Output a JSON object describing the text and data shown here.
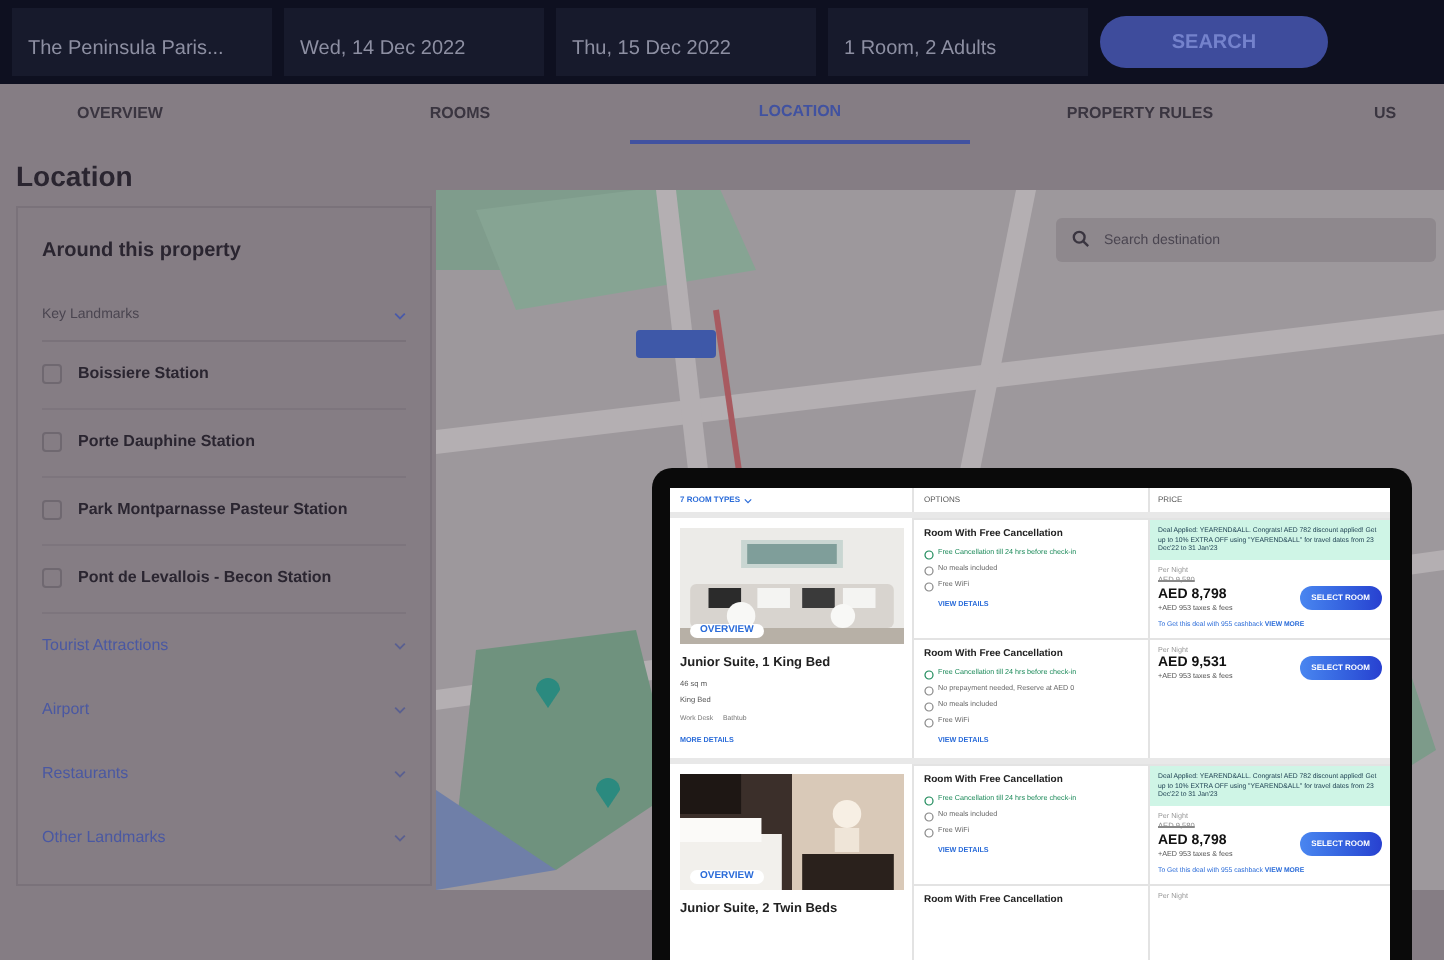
{
  "search_bar": {
    "fields": [
      {
        "value": "The Peninsula Paris..."
      },
      {
        "value": "Wed, 14 Dec 2022"
      },
      {
        "value": "Thu, 15 Dec 2022"
      },
      {
        "value": "1 Room, 2 Adults"
      }
    ],
    "button": "SEARCH"
  },
  "tabs": [
    {
      "label": "OVERVIEW",
      "selected": false
    },
    {
      "label": "ROOMS",
      "selected": false
    },
    {
      "label": "LOCATION",
      "selected": true
    },
    {
      "label": "PROPERTY RULES",
      "selected": false
    },
    {
      "label": "US",
      "selected": false
    }
  ],
  "location": {
    "title": "Location",
    "panel_title": "Around this property",
    "dropdown": "Key Landmarks",
    "landmarks": [
      {
        "name": "Boissiere Station",
        "checked": false
      },
      {
        "name": "Porte Dauphine Station",
        "checked": false
      },
      {
        "name": "Park Montparnasse Pasteur Station",
        "checked": false
      },
      {
        "name": "Pont de Levallois - Becon Station",
        "checked": false
      }
    ],
    "categories": [
      "Tourist Attractions",
      "Airport",
      "Restaurants",
      "Other Landmarks"
    ],
    "map": {
      "search_placeholder": "Search destination"
    }
  },
  "rooms_table": {
    "columns": [
      "7 ROOM TYPES",
      "OPTIONS",
      "PRICE"
    ],
    "rooms": [
      {
        "name": "Junior Suite, 1 King Bed",
        "badge": "OVERVIEW",
        "features": [
          "46 sq m",
          "King Bed"
        ],
        "amenities": [
          "Work Desk",
          "Bathtub"
        ],
        "more": "MORE DETAILS",
        "options": [
          {
            "title": "Room With Free Cancellation",
            "perks": [
              {
                "kind": "highlight",
                "text": "Free Cancellation till 24 hrs before check-in"
              },
              {
                "kind": "plain",
                "text": "No meals included"
              },
              {
                "kind": "plain",
                "text": "Free WiFi"
              }
            ],
            "link": "VIEW DETAILS",
            "price": {
              "deal": "Deal Applied: YEAREND&ALL. Congrats! AED 782 discount applied! Get up to 10% EXTRA OFF using \"YEAREND&ALL\" for travel dates from 23 Dec'22 to 31 Jan'23",
              "per_night": "Per Night",
              "original": "AED 9,580",
              "amount": "AED 8,798",
              "taxes": "+AED 953 taxes & fees",
              "note": "To Get this deal with 955 cashback",
              "note_link": "VIEW MORE",
              "button": "SELECT ROOM"
            }
          },
          {
            "title": "Room With Free Cancellation",
            "perks": [
              {
                "kind": "highlight",
                "text": "Free Cancellation till 24 hrs before check-in"
              },
              {
                "kind": "plain",
                "text": "No prepayment needed, Reserve at AED 0"
              },
              {
                "kind": "plain",
                "text": "No meals included"
              },
              {
                "kind": "plain",
                "text": "Free WiFi"
              }
            ],
            "link": "VIEW DETAILS",
            "price": {
              "per_night": "Per Night",
              "amount": "AED 9,531",
              "taxes": "+AED 953 taxes & fees",
              "button": "SELECT ROOM"
            }
          }
        ]
      },
      {
        "name": "Junior Suite, 2 Twin Beds",
        "badge": "OVERVIEW",
        "options": [
          {
            "title": "Room With Free Cancellation",
            "perks": [
              {
                "kind": "highlight",
                "text": "Free Cancellation till 24 hrs before check-in"
              },
              {
                "kind": "plain",
                "text": "No meals included"
              },
              {
                "kind": "plain",
                "text": "Free WiFi"
              }
            ],
            "link": "VIEW DETAILS",
            "price": {
              "deal": "Deal Applied: YEAREND&ALL. Congrats! AED 782 discount applied! Get up to 10% EXTRA OFF using \"YEAREND&ALL\" for travel dates from 23 Dec'22 to 31 Jan'23",
              "per_night": "Per Night",
              "original": "AED 9,580",
              "amount": "AED 8,798",
              "taxes": "+AED 953 taxes & fees",
              "note": "To Get this deal with 955 cashback",
              "note_link": "VIEW MORE",
              "button": "SELECT ROOM"
            }
          },
          {
            "title": "Room With Free Cancellation",
            "price": {
              "per_night": "Per Night"
            }
          }
        ]
      }
    ]
  }
}
